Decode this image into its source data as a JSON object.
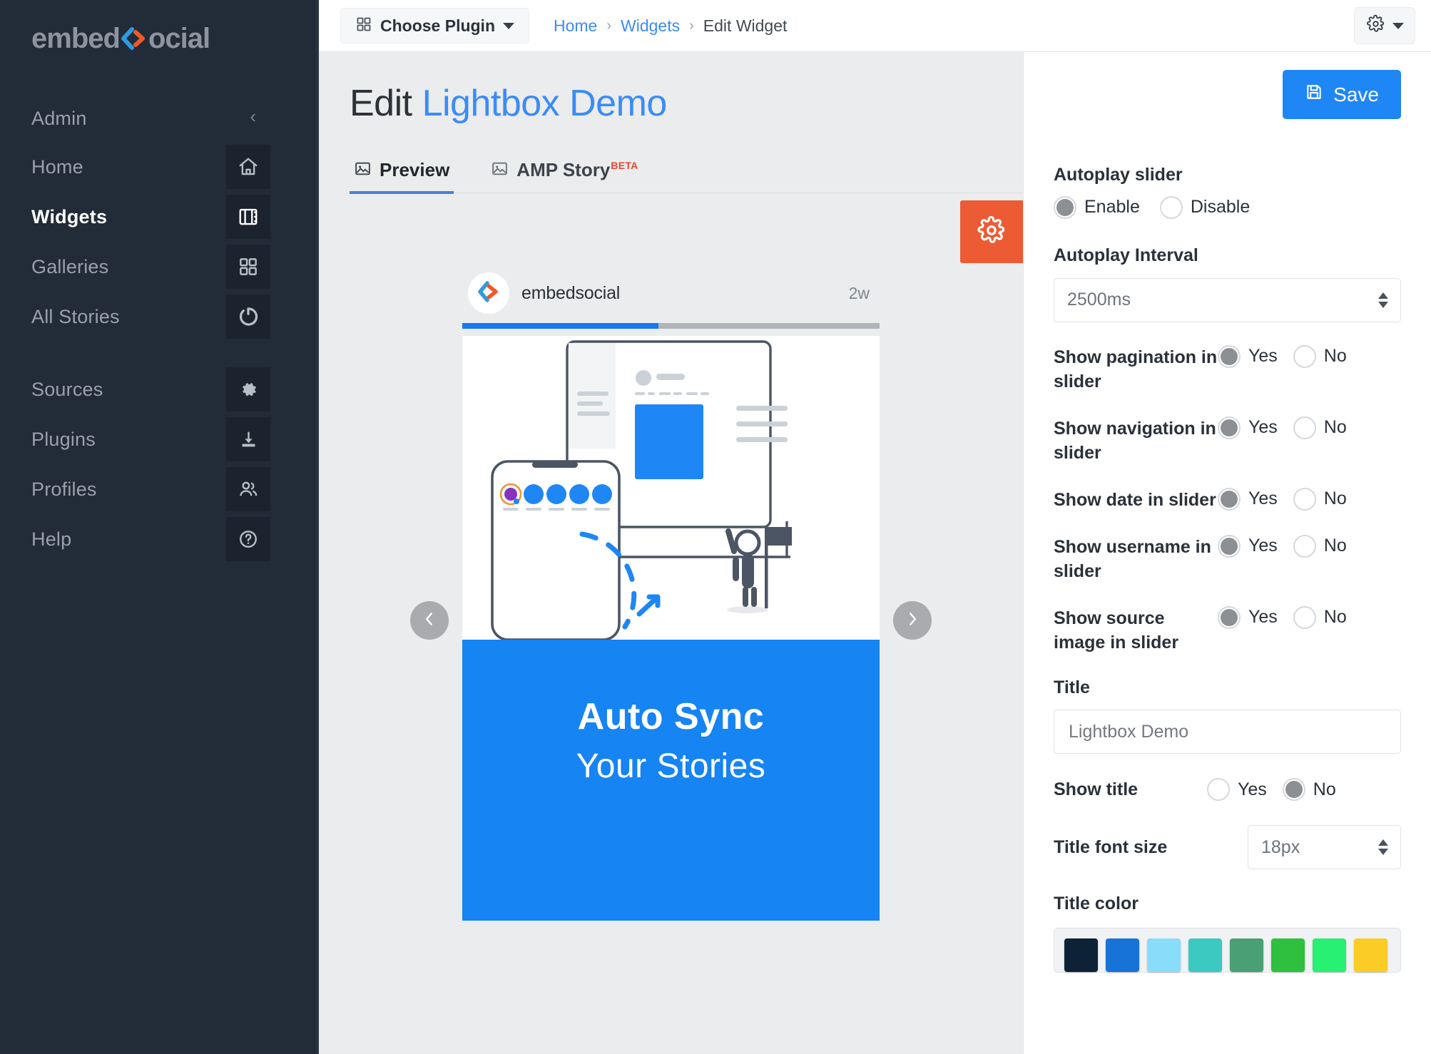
{
  "sidebar": {
    "logo": {
      "text_a": "embed",
      "text_b": "ocial",
      "icon": "chevrons-logo-icon"
    },
    "section_label": "Admin",
    "collapse_icon": "chevron-left-icon",
    "items": [
      {
        "label": "Home",
        "icon": "home-icon",
        "active": false
      },
      {
        "label": "Widgets",
        "icon": "film-strip-icon",
        "active": true
      },
      {
        "label": "Galleries",
        "icon": "grid-icon",
        "active": false
      },
      {
        "label": "All Stories",
        "icon": "circle-loader-icon",
        "active": false
      },
      {
        "label": "Sources",
        "icon": "gear-icon",
        "active": false
      },
      {
        "label": "Plugins",
        "icon": "download-icon",
        "active": false
      },
      {
        "label": "Profiles",
        "icon": "users-icon",
        "active": false
      },
      {
        "label": "Help",
        "icon": "question-circle-icon",
        "active": false
      }
    ]
  },
  "topbar": {
    "choose_plugin_label": "Choose Plugin",
    "choose_plugin_icon": "grid-icon",
    "caret_icon": "caret-down-icon",
    "breadcrumb": [
      {
        "label": "Home",
        "link": true
      },
      {
        "label": "Widgets",
        "link": true
      },
      {
        "label": "Edit Widget",
        "link": false
      }
    ],
    "separator": "›",
    "settings_menu_icon": "gear-icon",
    "settings_menu_caret": "caret-down-icon"
  },
  "page": {
    "title_prefix": "Edit",
    "title_widget": "Lightbox Demo",
    "tabs": [
      {
        "label": "Preview",
        "icon": "image-icon",
        "badge": "",
        "active": true
      },
      {
        "label": "AMP Story",
        "icon": "image-icon",
        "badge": "BETA",
        "active": false
      }
    ],
    "fab_icon": "gear-icon"
  },
  "preview": {
    "username": "embedsocial",
    "avatar_icon": "embedsocial-mark-icon",
    "age": "2w",
    "progress_percent": 47,
    "prev_icon": "chevron-left-icon",
    "next_icon": "chevron-right-icon",
    "slide_title_line1": "Auto Sync",
    "slide_title_line2": "Your Stories"
  },
  "settings": {
    "save_label": "Save",
    "save_icon": "floppy-disk-icon",
    "autoplay_slider": {
      "label": "Autoplay slider",
      "options": [
        "Enable",
        "Disable"
      ],
      "selected": "Enable"
    },
    "autoplay_interval": {
      "label": "Autoplay Interval",
      "value": "2500ms"
    },
    "toggles": [
      {
        "label": "Show pagination in slider",
        "yes": "Yes",
        "no": "No",
        "selected": "Yes"
      },
      {
        "label": "Show navigation in slider",
        "yes": "Yes",
        "no": "No",
        "selected": "Yes"
      },
      {
        "label": "Show date in slider",
        "yes": "Yes",
        "no": "No",
        "selected": "Yes"
      },
      {
        "label": "Show username in slider",
        "yes": "Yes",
        "no": "No",
        "selected": "Yes"
      },
      {
        "label": "Show source image in slider",
        "yes": "Yes",
        "no": "No",
        "selected": "Yes"
      }
    ],
    "title_field": {
      "label": "Title",
      "value": "Lightbox Demo",
      "placeholder": "Lightbox Demo"
    },
    "show_title": {
      "label": "Show title",
      "yes": "Yes",
      "no": "No",
      "selected": "No"
    },
    "title_font_size": {
      "label": "Title font size",
      "value": "18px"
    },
    "title_color": {
      "label": "Title color",
      "swatches": [
        "#0d2236",
        "#1773d8",
        "#8adcfb",
        "#3bc9c2",
        "#4a9f74",
        "#2fc03f",
        "#27f072",
        "#fbcc25"
      ]
    }
  },
  "colors": {
    "accent_blue": "#1f86f5",
    "link_blue": "#3b8cf5",
    "sidebar_bg": "#222b38",
    "fab_orange": "#ec5b33",
    "beta_red": "#e8442e"
  }
}
